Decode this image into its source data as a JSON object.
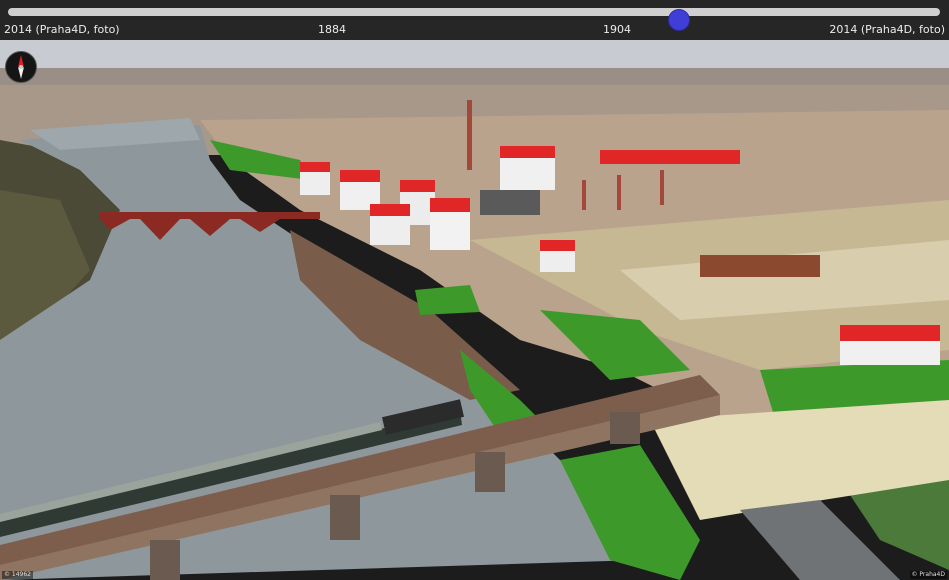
{
  "timeline": {
    "left_label": "2014 (Praha4D, foto)",
    "right_label": "2014 (Praha4D, foto)",
    "ticks": [
      "1884",
      "1904"
    ],
    "slider_position": 0.72,
    "thumb_color": "#3f3fd8"
  },
  "compass": {
    "icon": "compass-icon"
  },
  "footer": {
    "left": "© 14962",
    "right": "© Praha4D"
  },
  "colors": {
    "roofs": "#e02626",
    "grass": "#3d9a2a",
    "river": "#8a9598",
    "bridge": "#8c6a55",
    "iron_bridge": "#8b2a22"
  }
}
